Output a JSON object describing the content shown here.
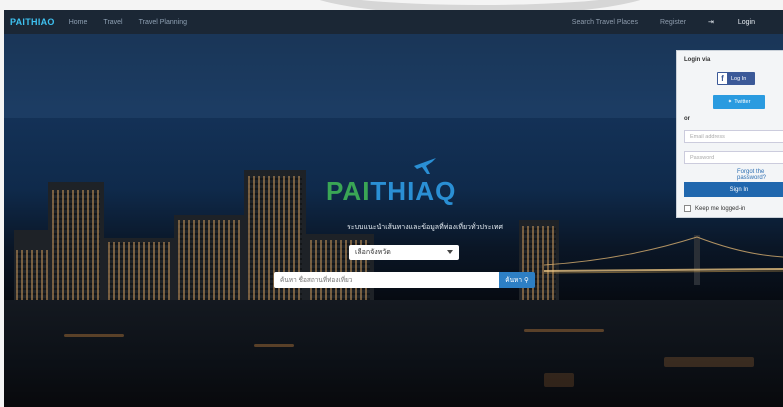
{
  "navbar": {
    "brand": "PAITHIAO",
    "links": [
      "Home",
      "Travel",
      "Travel Planning"
    ],
    "right_items": [
      "Search Travel Places",
      "Register"
    ],
    "login_label": "Login"
  },
  "hero": {
    "logo_part1": "PAI",
    "logo_part2": "THIA",
    "logo_part3": "Q",
    "tagline": "ระบบแนะนำเส้นทางและข้อมูลที่ท่องเที่ยวทั่วประเทศ",
    "province_select": {
      "selected": "เลือกจังหวัด"
    },
    "search": {
      "placeholder": "ค้นหา ชื่อสถานที่ท่องเที่ยว",
      "button_label": "ค้นหา"
    }
  },
  "login_panel": {
    "title": "Login via",
    "facebook_label": "Log In",
    "twitter_label": "Twitter",
    "or_label": "or",
    "email_placeholder": "Email address",
    "password_placeholder": "Password",
    "forgot_label": "Forgot the password?",
    "signin_label": "Sign In",
    "keep_label": "Keep me logged-in"
  },
  "colors": {
    "brand_blue": "#3ec1f0",
    "logo_green": "#3aa655",
    "logo_blue": "#2a8fd4",
    "button_blue": "#2d7fc4",
    "facebook": "#3b5998",
    "twitter": "#2a9be0"
  }
}
